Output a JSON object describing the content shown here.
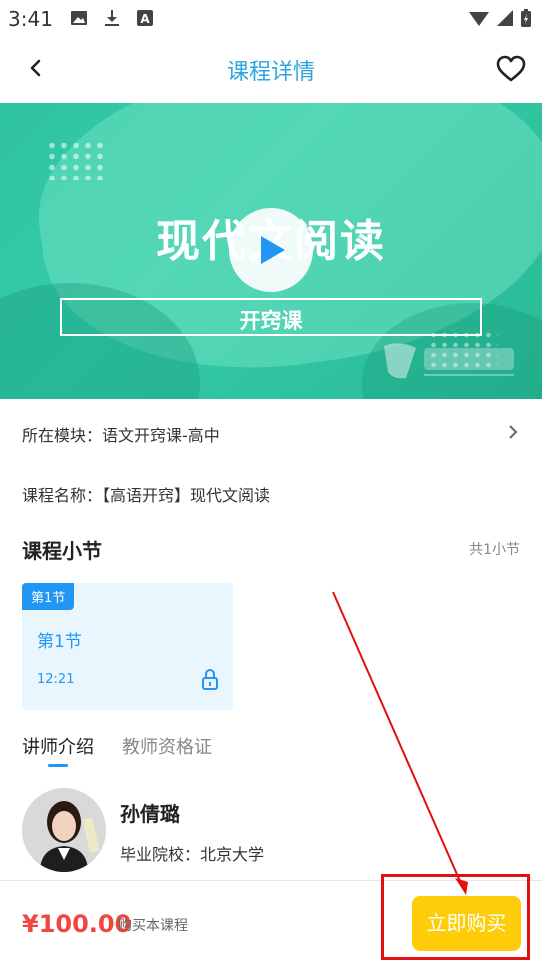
{
  "status_bar": {
    "time": "3:41"
  },
  "header": {
    "title": "课程详情"
  },
  "banner": {
    "title": "现代文阅读",
    "subtitle": "开窍课"
  },
  "info": {
    "module_label": "所在模块：语文开窍课-高中",
    "course_name_label": "课程名称：【高语开窍】现代文阅读"
  },
  "sections": {
    "heading": "课程小节",
    "count": "共1小节",
    "lessons": [
      {
        "tag": "第1节",
        "title": "第1节",
        "duration": "12:21"
      }
    ]
  },
  "tabs": [
    "讲师介绍",
    "教师资格证"
  ],
  "teacher": {
    "name": "孙倩璐",
    "school": "毕业院校：北京大学"
  },
  "purchase": {
    "price": "¥100.00",
    "note": "购买本课程",
    "button": "立即购买"
  },
  "colors": {
    "accent": "#2ba5e0",
    "price": "#f0463e",
    "buy": "#ffcc0a",
    "annotation": "#e01010"
  }
}
